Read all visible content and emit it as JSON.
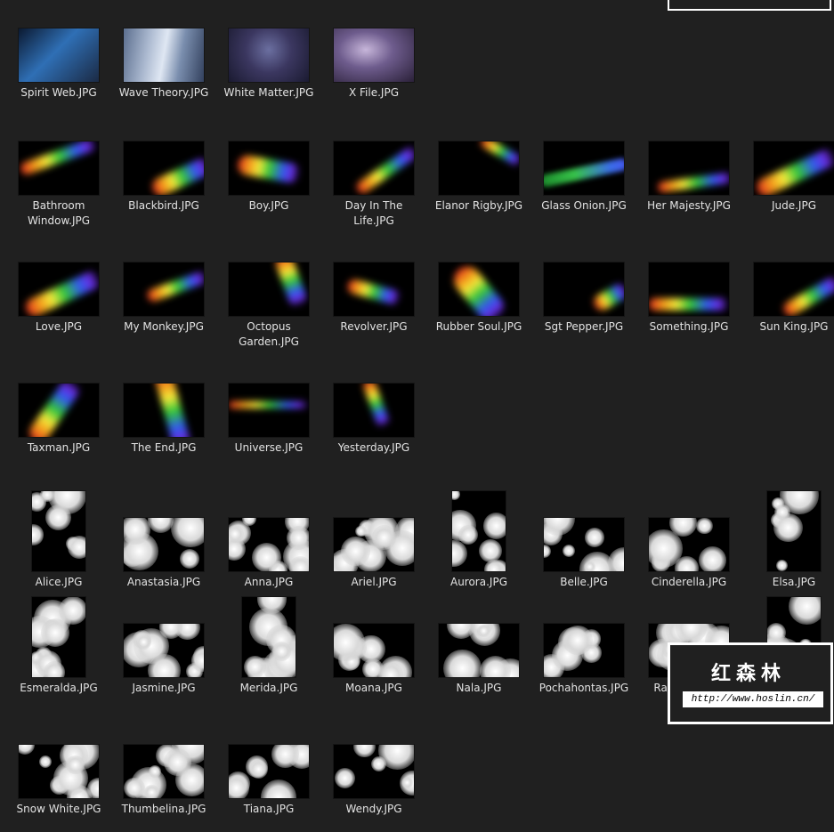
{
  "files": [
    {
      "name": "Spirit Web.JPG",
      "art": "blue"
    },
    {
      "name": "Wave Theory.JPG",
      "art": "wave"
    },
    {
      "name": "White Matter.JPG",
      "art": "matter"
    },
    {
      "name": "X File.JPG",
      "art": "xfile"
    },
    {
      "name": "Bathroom Window.JPG",
      "art": "rainbow"
    },
    {
      "name": "Blackbird.JPG",
      "art": "rainbow"
    },
    {
      "name": "Boy.JPG",
      "art": "rainbow"
    },
    {
      "name": "Day In The Life.JPG",
      "art": "rainbow"
    },
    {
      "name": "Elanor Rigby.JPG",
      "art": "rainbow"
    },
    {
      "name": "Glass Onion.JPG",
      "art": "glass"
    },
    {
      "name": "Her Majesty.JPG",
      "art": "rainbow"
    },
    {
      "name": "Jude.JPG",
      "art": "rainbow"
    },
    {
      "name": "Love.JPG",
      "art": "rainbow"
    },
    {
      "name": "My Monkey.JPG",
      "art": "rainbow"
    },
    {
      "name": "Octopus Garden.JPG",
      "art": "rainbow"
    },
    {
      "name": "Revolver.JPG",
      "art": "rainbow"
    },
    {
      "name": "Rubber Soul.JPG",
      "art": "rainbow"
    },
    {
      "name": "Sgt Pepper.JPG",
      "art": "rainbow"
    },
    {
      "name": "Something.JPG",
      "art": "rainbow"
    },
    {
      "name": "Sun King.JPG",
      "art": "rainbow"
    },
    {
      "name": "Taxman.JPG",
      "art": "rainbow"
    },
    {
      "name": "The End.JPG",
      "art": "rainbow"
    },
    {
      "name": "Universe.JPG",
      "art": "rainbow"
    },
    {
      "name": "Yesterday.JPG",
      "art": "rainbow"
    },
    {
      "name": "Alice.JPG",
      "art": "bokeh"
    },
    {
      "name": "Anastasia.JPG",
      "art": "bokeh"
    },
    {
      "name": "Anna.JPG",
      "art": "bokeh"
    },
    {
      "name": "Ariel.JPG",
      "art": "bokeh"
    },
    {
      "name": "Aurora.JPG",
      "art": "bokeh"
    },
    {
      "name": "Belle.JPG",
      "art": "bokeh"
    },
    {
      "name": "Cinderella.JPG",
      "art": "bokeh"
    },
    {
      "name": "Elsa.JPG",
      "art": "bokeh"
    },
    {
      "name": "Esmeralda.JPG",
      "art": "bokeh"
    },
    {
      "name": "Jasmine.JPG",
      "art": "bokeh"
    },
    {
      "name": "Merida.JPG",
      "art": "bokeh"
    },
    {
      "name": "Moana.JPG",
      "art": "bokeh"
    },
    {
      "name": "Nala.JPG",
      "art": "bokeh"
    },
    {
      "name": "Pochahontas.JPG",
      "art": "bokeh"
    },
    {
      "name": "Rapunzel.JPG",
      "art": "bokeh"
    },
    {
      "name": "Sally.JPG",
      "art": "bokeh"
    },
    {
      "name": "Snow White.JPG",
      "art": "bokeh"
    },
    {
      "name": "Thumbelina.JPG",
      "art": "bokeh"
    },
    {
      "name": "Tiana.JPG",
      "art": "bokeh"
    },
    {
      "name": "Wendy.JPG",
      "art": "bokeh"
    }
  ],
  "watermark": {
    "title": "红森林",
    "url": "http://www.hoslin.cn/"
  }
}
